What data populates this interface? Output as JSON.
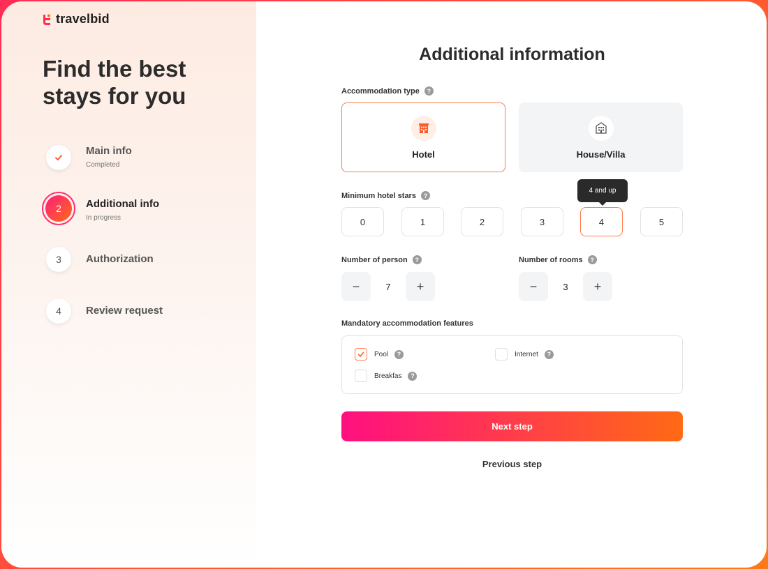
{
  "brand": {
    "name": "travelbid",
    "color": "#ff2d55"
  },
  "sidebar": {
    "headline": "Find the best stays for you",
    "steps": [
      {
        "number": "✓",
        "title": "Main info",
        "status": "Completed"
      },
      {
        "number": "2",
        "title": "Additional info",
        "status": "In progress"
      },
      {
        "number": "3",
        "title": "Authorization",
        "status": ""
      },
      {
        "number": "4",
        "title": "Review request",
        "status": ""
      }
    ]
  },
  "form": {
    "title": "Additional information",
    "accommodation": {
      "label": "Accommodation type",
      "options": [
        {
          "label": "Hotel",
          "icon": "hotel-icon",
          "selected": true
        },
        {
          "label": "House/Villa",
          "icon": "villa-icon",
          "selected": false
        }
      ]
    },
    "stars": {
      "label": "Minimum hotel stars",
      "options": [
        "0",
        "1",
        "2",
        "3",
        "4",
        "5"
      ],
      "selected": "4",
      "tooltip": "4 and up"
    },
    "persons": {
      "label": "Number of person",
      "value": "7",
      "minus": "−",
      "plus": "+"
    },
    "rooms": {
      "label": "Number of rooms",
      "value": "3",
      "minus": "−",
      "plus": "+"
    },
    "features": {
      "label": "Mandatory accommodation features",
      "items": [
        {
          "label": "Pool",
          "checked": true
        },
        {
          "label": "Internet",
          "checked": false
        },
        {
          "label": "Breakfas",
          "checked": false
        }
      ]
    },
    "next_label": "Next step",
    "prev_label": "Previous step"
  },
  "help_glyph": "?"
}
